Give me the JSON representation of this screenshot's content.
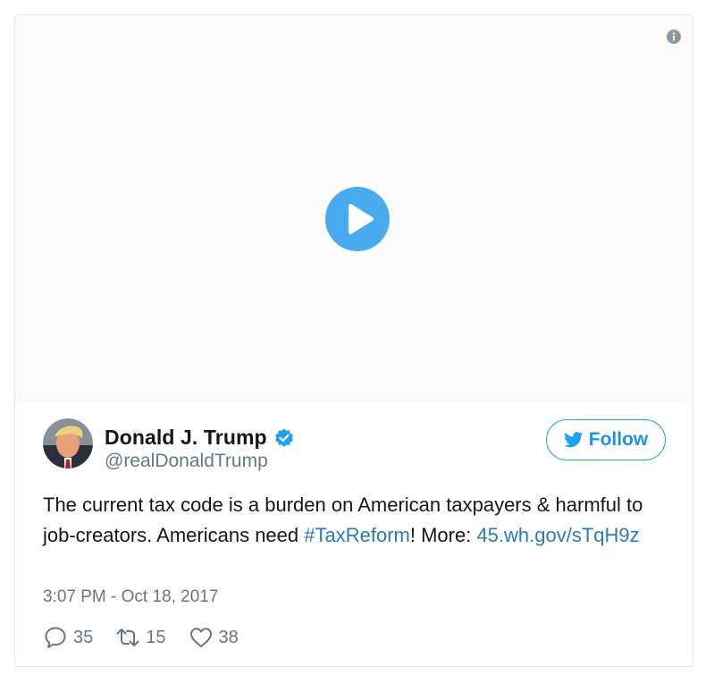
{
  "video": {
    "info_icon": "info-icon",
    "play_icon": "play-icon"
  },
  "tweet": {
    "display_name": "Donald J. Trump",
    "handle": "@realDonaldTrump",
    "verified_icon": "verified-badge-icon",
    "follow_label": "Follow",
    "follow_icon": "twitter-bird-icon",
    "text_part1": "The current tax code is a burden on American taxpayers & harmful to job-creators. Americans need ",
    "hashtag": "#TaxReform",
    "text_part2": "! More: ",
    "link": "45.wh.gov/sTqH9z",
    "timestamp": "3:07 PM - Oct 18, 2017",
    "replies": "35",
    "retweets": "15",
    "likes": "38"
  },
  "colors": {
    "accent": "#1da1f2",
    "link": "#2b7bb9",
    "secondary_text": "#657786",
    "primary_text": "#14171a",
    "play_button": "#4aaaf0"
  }
}
